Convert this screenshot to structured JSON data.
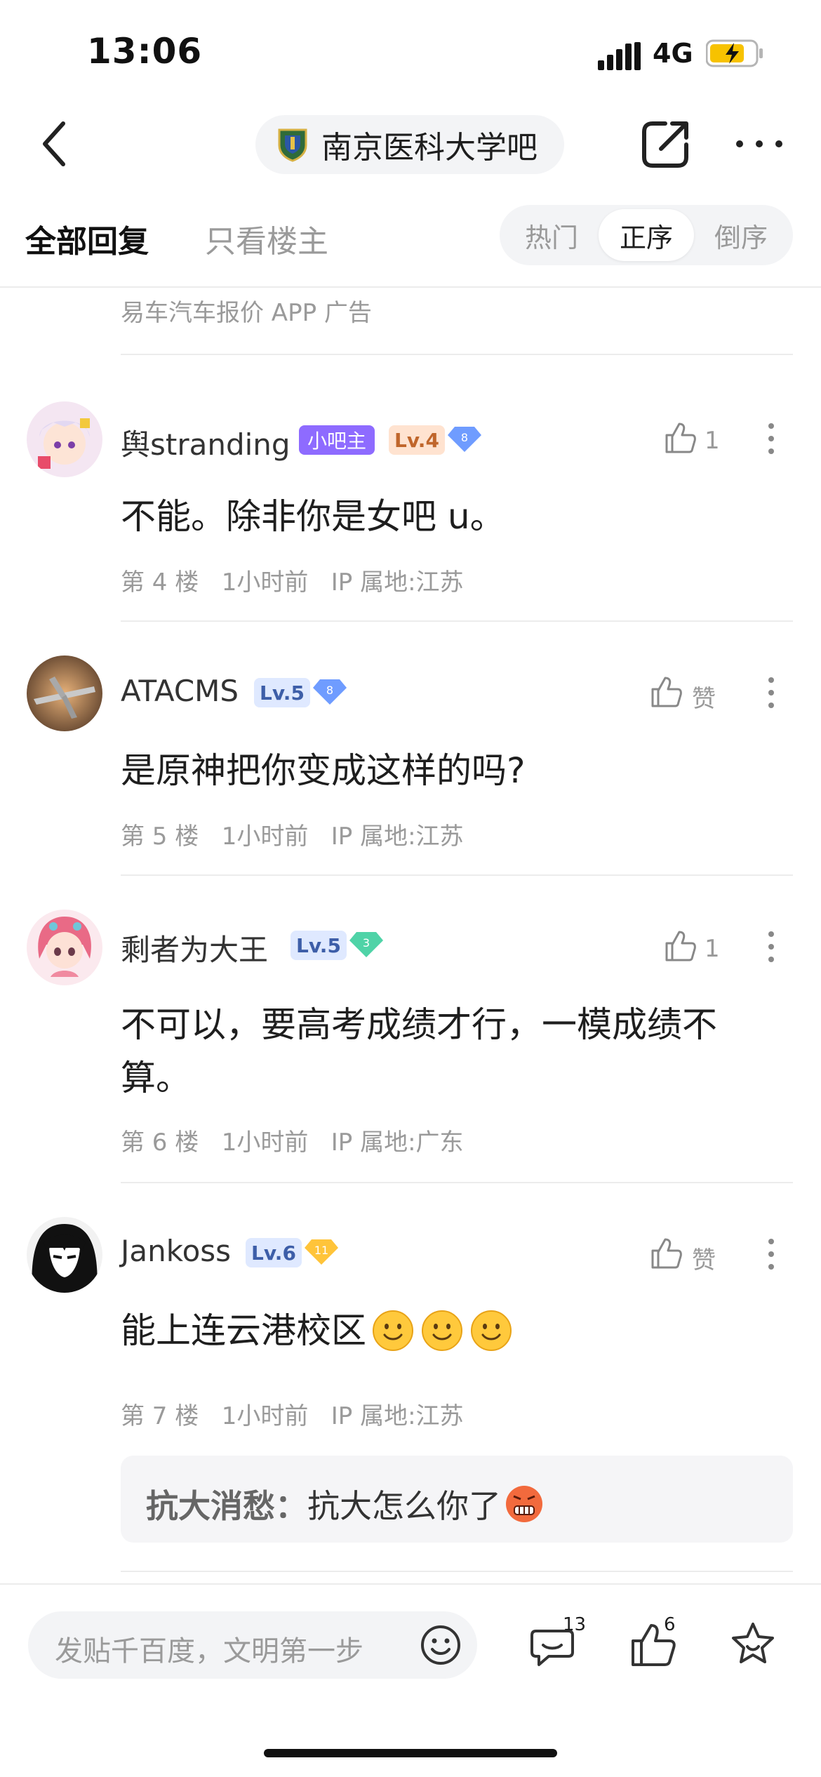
{
  "status": {
    "time": "13:06",
    "network": "4G"
  },
  "nav": {
    "forum_name": "南京医科大学吧"
  },
  "tabs": {
    "all": "全部回复",
    "op_only": "只看楼主"
  },
  "sort": {
    "hot": "热门",
    "asc": "正序",
    "desc": "倒序",
    "active": "正序"
  },
  "ad": {
    "text": "易车汽车报价  APP  广告"
  },
  "posts": [
    {
      "username": "舆stranding",
      "admin_badge": "小吧主",
      "level": "Lv.4",
      "gem": "8",
      "likes": "1",
      "content": "不能。除非你是女吧 u。",
      "floor": "第 4 楼",
      "time": "1小时前",
      "ip": "IP 属地:江苏"
    },
    {
      "username": "ATACMS",
      "level": "Lv.5",
      "gem": "8",
      "likes": "赞",
      "content": "是原神把你变成这样的吗?",
      "floor": "第 5 楼",
      "time": "1小时前",
      "ip": "IP 属地:江苏"
    },
    {
      "username": "剩者为大王",
      "level": "Lv.5",
      "gem": "3",
      "likes": "1",
      "content_line1": "不可以，要高考成绩才行，一模成绩不",
      "content_line2": "算。",
      "floor": "第 6 楼",
      "time": "1小时前",
      "ip": "IP 属地:广东"
    },
    {
      "username": "Jankoss",
      "level": "Lv.6",
      "gem": "11",
      "likes": "赞",
      "content": "能上连云港校区",
      "floor": "第 7 楼",
      "time": "1小时前",
      "ip": "IP 属地:江苏",
      "reply": {
        "author": "抗大消愁：",
        "text": "抗大怎么你了"
      }
    }
  ],
  "bottom": {
    "placeholder": "发贴千百度，文明第一步",
    "comments_count": "13",
    "likes_count": "6"
  },
  "colors": {
    "admin_badge": "#8e6bff",
    "gem_blue": "#6f9cff",
    "gem_green": "#4fd3a7",
    "gem_gold": "#ffc43a"
  }
}
